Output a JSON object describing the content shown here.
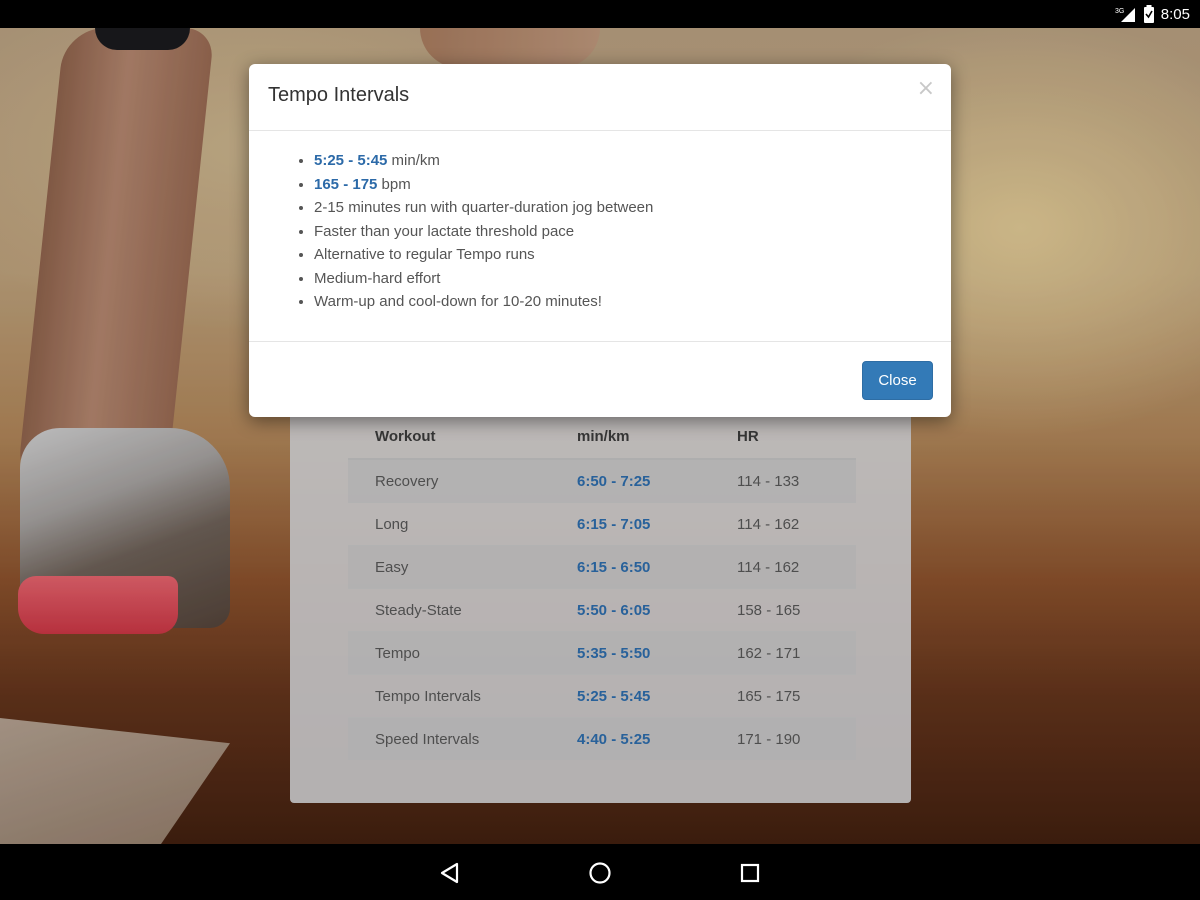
{
  "status_bar": {
    "network": "3G",
    "time": "8:05"
  },
  "modal": {
    "title": "Tempo Intervals",
    "close_x": "×",
    "items": [
      {
        "value": "5:25 - 5:45",
        "text": " min/km"
      },
      {
        "value": "165 - 175",
        "text": " bpm"
      },
      {
        "text": "2-15 minutes run with quarter-duration jog between"
      },
      {
        "text": "Faster than your lactate threshold pace"
      },
      {
        "text": "Alternative to regular Tempo runs"
      },
      {
        "text": "Medium-hard effort"
      },
      {
        "text": "Warm-up and cool-down for 10-20 minutes!"
      }
    ],
    "close_label": "Close"
  },
  "table": {
    "headers": [
      "Workout",
      "min/km",
      "HR"
    ],
    "rows": [
      [
        "Recovery",
        "6:50 - 7:25",
        "114 - 133"
      ],
      [
        "Long",
        "6:15 - 7:05",
        "114 - 162"
      ],
      [
        "Easy",
        "6:15 - 6:50",
        "114 - 162"
      ],
      [
        "Steady-State",
        "5:50 - 6:05",
        "158 - 165"
      ],
      [
        "Tempo",
        "5:35 - 5:50",
        "162 - 171"
      ],
      [
        "Tempo Intervals",
        "5:25 - 5:45",
        "165 - 175"
      ],
      [
        "Speed Intervals",
        "4:40 - 5:25",
        "171 - 190"
      ]
    ]
  },
  "nav": {
    "icons": [
      "back-icon",
      "home-icon",
      "recents-icon"
    ]
  },
  "colors": {
    "accent": "#337ab7",
    "pace_text": "#2c6aa8"
  }
}
